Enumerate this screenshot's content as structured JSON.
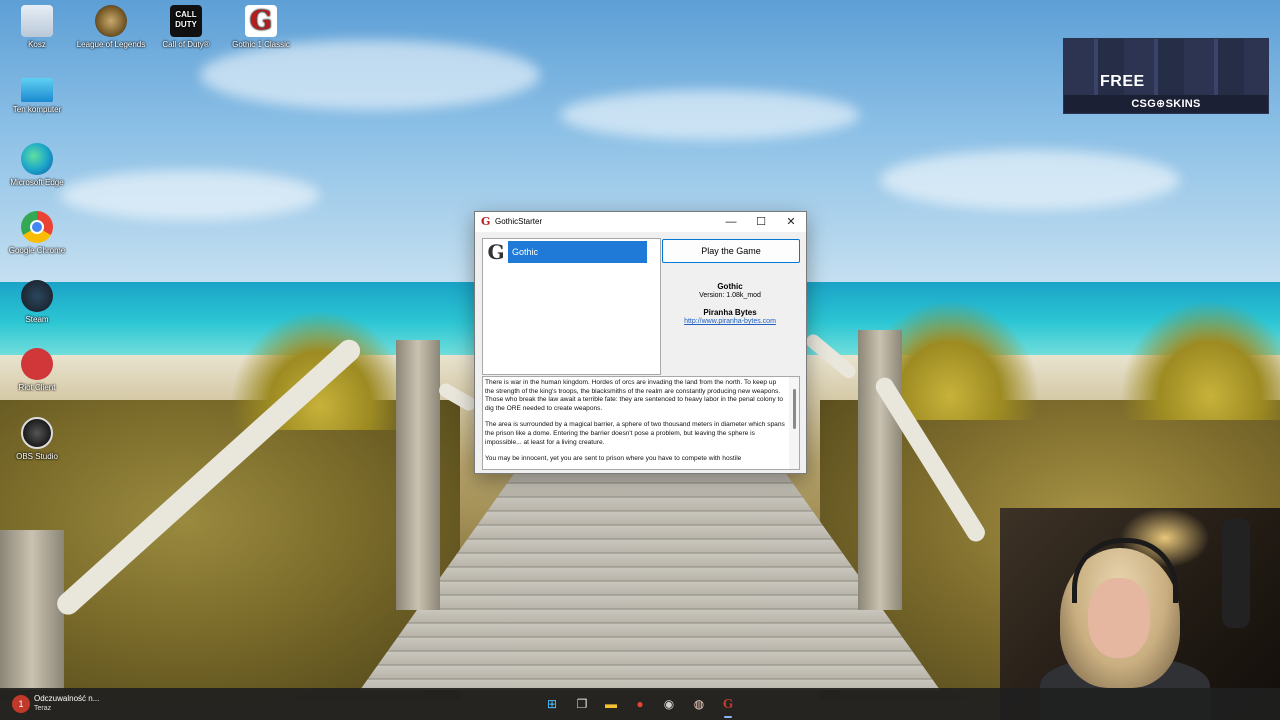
{
  "desktop": {
    "icons": [
      {
        "label": "Kosz",
        "icon": "recycle-bin-icon"
      },
      {
        "label": "League of Legends",
        "icon": "league-of-legends-icon"
      },
      {
        "label": "Call of Duty®",
        "icon": "call-of-duty-icon"
      },
      {
        "label": "Gothic 1 Classic",
        "icon": "gothic-icon"
      },
      {
        "label": "Ten komputer",
        "icon": "this-pc-icon"
      },
      {
        "label": "Microsoft Edge",
        "icon": "edge-icon"
      },
      {
        "label": "Google Chrome",
        "icon": "chrome-icon"
      },
      {
        "label": "Steam",
        "icon": "steam-icon"
      },
      {
        "label": "Riot Client",
        "icon": "riot-client-icon"
      },
      {
        "label": "OBS Studio",
        "icon": "obs-icon"
      }
    ],
    "cod_icon_text": "CALL\nDUTY"
  },
  "ad": {
    "free": "FREE",
    "brand": "CSG⊕SKINS"
  },
  "window": {
    "title": "GothicStarter",
    "minimize_glyph": "—",
    "maximize_glyph": "☐",
    "close_glyph": "✕",
    "game_list": [
      {
        "name": "Gothic",
        "icon": "gothic-g-icon",
        "selected": true
      }
    ],
    "play_button": "Play the Game",
    "game_name": "Gothic",
    "version": "Version: 1.08k_mod",
    "developer": "Piranha Bytes",
    "website": "http://www.piranha-bytes.com",
    "description": [
      "There is war in the human kingdom. Hordes of orcs are invading the land from the north. To keep up the strength of the king's troops, the blacksmiths of the realm are constantly producing new weapons. Those who break the law await a terrible fate: they are sentenced to heavy labor in the penal colony to dig the ORE needed to create weapons.",
      "The area is surrounded by a magical barrier, a sphere of two thousand meters in diameter which spans the prison like a dome. Entering the barrier doesn't pose a problem, but leaving the sphere is impossible... at least for a living creature.",
      "You may be innocent, yet you are sent to prison where you have to compete with hostile"
    ]
  },
  "taskbar": {
    "notification_title": "Odczuwalność n...",
    "notification_time": "Teraz",
    "notification_badge": "1",
    "apps": [
      {
        "name": "start-button",
        "glyph": "⊞",
        "color": "#4cc2ff"
      },
      {
        "name": "task-view-button",
        "glyph": "❐",
        "color": "#e0e0e0"
      },
      {
        "name": "file-explorer-button",
        "glyph": "▬",
        "color": "#f4c430"
      },
      {
        "name": "chrome-taskbar-button",
        "glyph": "●",
        "color": "#e94235"
      },
      {
        "name": "obs-taskbar-button",
        "glyph": "◉",
        "color": "#d0d0d0"
      },
      {
        "name": "app-taskbar-button",
        "glyph": "◍",
        "color": "#f0d0c0"
      },
      {
        "name": "gothic-taskbar-button",
        "glyph": "G",
        "color": "#c0392b"
      }
    ]
  }
}
